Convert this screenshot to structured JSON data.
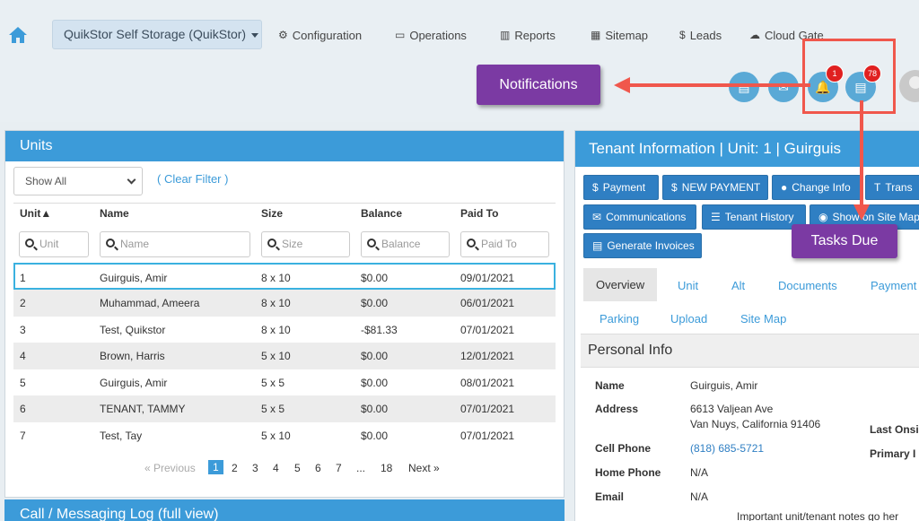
{
  "nav": {
    "facility": "QuikStor Self Storage (QuikStor)",
    "items": [
      {
        "label": "Configuration",
        "icon": "gears-icon",
        "glyph": "⚙"
      },
      {
        "label": "Operations",
        "icon": "monitor-icon",
        "glyph": "▭"
      },
      {
        "label": "Reports",
        "icon": "bar-chart-icon",
        "glyph": "▥"
      },
      {
        "label": "Sitemap",
        "icon": "map-icon",
        "glyph": "▦"
      },
      {
        "label": "Leads",
        "icon": "dollar-icon",
        "glyph": "$"
      },
      {
        "label": "Cloud Gate",
        "icon": "cloud-gate-icon",
        "glyph": "☁"
      }
    ],
    "notification_count": "1",
    "tasks_count": "78"
  },
  "callouts": {
    "notifications": "Notifications",
    "tasks_due": "Tasks Due"
  },
  "units": {
    "title": "Units",
    "filter": "Show All",
    "clear_filter": "( Clear Filter )",
    "columns": [
      "Unit▲",
      "Name",
      "Size",
      "Balance",
      "Paid To"
    ],
    "search_placeholders": [
      "Unit",
      "Name",
      "Size",
      "Balance",
      "Paid To"
    ],
    "rows": [
      {
        "unit": "1",
        "name": "Guirguis, Amir",
        "size": "8 x 10",
        "balance": "$0.00",
        "paid_to": "09/01/2021"
      },
      {
        "unit": "2",
        "name": "Muhammad, Ameera",
        "size": "8 x 10",
        "balance": "$0.00",
        "paid_to": "06/01/2021"
      },
      {
        "unit": "3",
        "name": "Test, Quikstor",
        "size": "8 x 10",
        "balance": "-$81.33",
        "paid_to": "07/01/2021"
      },
      {
        "unit": "4",
        "name": "Brown, Harris",
        "size": "5 x 10",
        "balance": "$0.00",
        "paid_to": "12/01/2021"
      },
      {
        "unit": "5",
        "name": "Guirguis, Amir",
        "size": "5 x 5",
        "balance": "$0.00",
        "paid_to": "08/01/2021"
      },
      {
        "unit": "6",
        "name": "TENANT, TAMMY",
        "size": "5 x 5",
        "balance": "$0.00",
        "paid_to": "07/01/2021"
      },
      {
        "unit": "7",
        "name": "Test, Tay",
        "size": "5 x 10",
        "balance": "$0.00",
        "paid_to": "07/01/2021"
      }
    ],
    "pagination": {
      "previous": "« Previous",
      "pages": [
        "1",
        "2",
        "3",
        "4",
        "5",
        "6",
        "7",
        "...",
        "18"
      ],
      "next": "Next »"
    }
  },
  "log": {
    "title": "Call / Messaging Log  (full view)"
  },
  "tenant": {
    "title": "Tenant Information | Unit: 1 | Guirguis",
    "buttons": [
      {
        "label": "Payment",
        "icon": "dollar-icon",
        "glyph": "$"
      },
      {
        "label": "NEW PAYMENT",
        "icon": "dollar-icon",
        "glyph": "$"
      },
      {
        "label": "Change Info",
        "icon": "user-icon",
        "glyph": "👤"
      },
      {
        "label": "Trans",
        "icon": "text-icon",
        "glyph": "T"
      },
      {
        "label": "Communications",
        "icon": "envelope-icon",
        "glyph": "✉"
      },
      {
        "label": "Tenant History",
        "icon": "list-icon",
        "glyph": "☰"
      },
      {
        "label": "Show on Site Map",
        "icon": "map-marker-icon",
        "glyph": "⚲"
      },
      {
        "label": "Generate Invoices",
        "icon": "document-icon",
        "glyph": "▤"
      }
    ],
    "tabs": [
      "Overview",
      "Unit",
      "Alt",
      "Documents",
      "Payment",
      "Parking",
      "Upload",
      "Site Map"
    ],
    "section": "Personal Info",
    "fields": {
      "name_label": "Name",
      "name": "Guirguis, Amir",
      "address_label": "Address",
      "address1": "6613 Valjean Ave",
      "address2": "Van Nuys, California 91406",
      "cell_label": "Cell Phone",
      "cell": "(818) 685-5721",
      "home_label": "Home Phone",
      "home": "N/A",
      "email_label": "Email",
      "email": "N/A",
      "last_onsite_label": "Last Onsi",
      "primary_label": "Primary I",
      "note": "Important unit/tenant notes go her"
    }
  },
  "colors": {
    "header_blue": "#3c9bd9",
    "button_blue": "#2f7fc3",
    "callout_purple": "#7b3aa3",
    "annotation_red": "#f0574c",
    "badge_red": "#e02020"
  }
}
